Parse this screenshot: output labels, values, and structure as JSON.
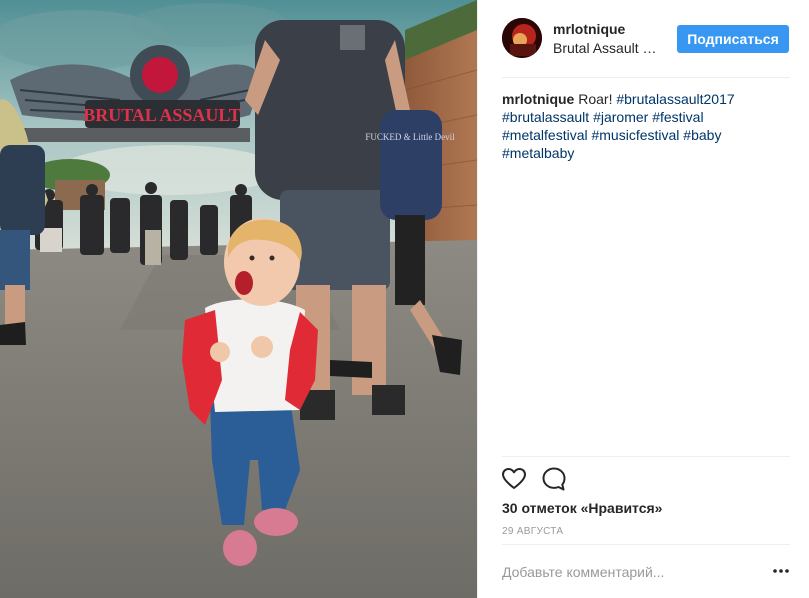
{
  "post": {
    "username": "mrlotnique",
    "location": "Brutal Assault Open Air",
    "follow_label": "Подписаться",
    "caption": {
      "text": "Roar!",
      "hashtags": [
        "#brutalassault2017",
        "#brutalassault",
        "#jaromer",
        "#festival",
        "#metalfestival",
        "#musicfestival",
        "#baby",
        "#metalbaby"
      ]
    },
    "likes": "30 отметок «Нравится»",
    "date": "29 АВГУСТА",
    "comment_placeholder": "Добавьте комментарий...",
    "more_label": "•••"
  },
  "photo": {
    "sign_text": "BRUTAL ASSAULT",
    "shirt_text": "FUCKED & Little Devil"
  },
  "icons": {
    "like": "heart-outline-icon",
    "comment": "comment-bubble-icon",
    "more": "more-options-icon"
  },
  "colors": {
    "follow_button": "#3897f0",
    "hashtag": "#003569",
    "meta_text": "#999999"
  }
}
